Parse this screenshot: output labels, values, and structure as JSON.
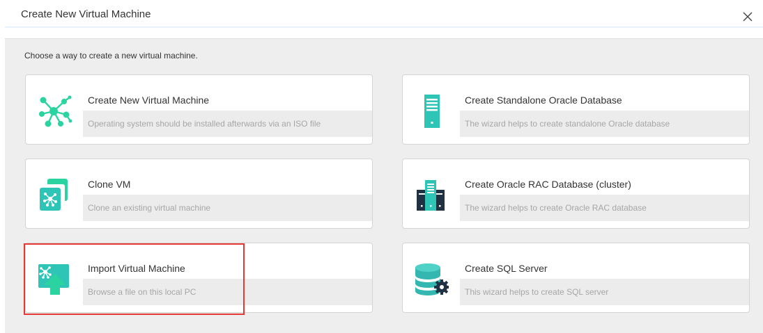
{
  "dialog": {
    "title": "Create New Virtual Machine",
    "close_icon": "close-icon",
    "instruction": "Choose a way to create a new virtual machine."
  },
  "options": [
    {
      "title": "Create New Virtual Machine",
      "description": "Operating system should be installed afterwards via an ISO file",
      "icon": "network-nodes-icon"
    },
    {
      "title": "Create Standalone Oracle Database",
      "description": "The wizard helps to create standalone Oracle database",
      "icon": "server-tower-icon"
    },
    {
      "title": "Clone VM",
      "description": "Clone an existing virtual machine",
      "icon": "clone-vm-icon"
    },
    {
      "title": "Create Oracle RAC Database (cluster)",
      "description": "The wizard helps to create Oracle RAC database",
      "icon": "server-cluster-icon"
    },
    {
      "title": "Import Virtual Machine",
      "description": "Browse a file on this local PC",
      "icon": "import-upload-icon"
    },
    {
      "title": "Create SQL Server",
      "description": "This wizard helps to create SQL server",
      "icon": "database-gear-icon"
    }
  ],
  "colors": {
    "accent_green": "#2bd3a0",
    "accent_teal": "#2ec4b6",
    "dark_navy": "#1f3142",
    "highlight_red": "#e53935",
    "db_teal": "#33b7b0"
  }
}
